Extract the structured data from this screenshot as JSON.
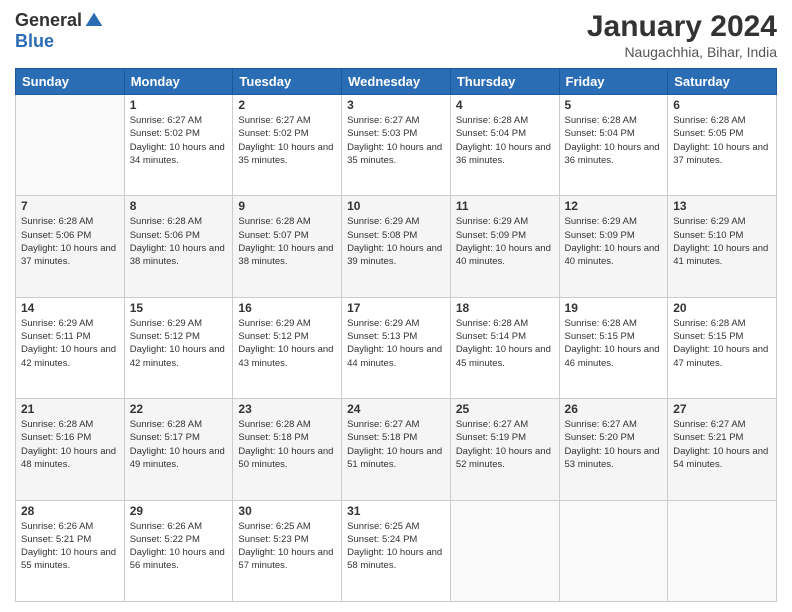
{
  "logo": {
    "general": "General",
    "blue": "Blue"
  },
  "title": "January 2024",
  "location": "Naugachhia, Bihar, India",
  "days_header": [
    "Sunday",
    "Monday",
    "Tuesday",
    "Wednesday",
    "Thursday",
    "Friday",
    "Saturday"
  ],
  "weeks": [
    [
      {
        "day": "",
        "sunrise": "",
        "sunset": "",
        "daylight": ""
      },
      {
        "day": "1",
        "sunrise": "Sunrise: 6:27 AM",
        "sunset": "Sunset: 5:02 PM",
        "daylight": "Daylight: 10 hours and 34 minutes."
      },
      {
        "day": "2",
        "sunrise": "Sunrise: 6:27 AM",
        "sunset": "Sunset: 5:02 PM",
        "daylight": "Daylight: 10 hours and 35 minutes."
      },
      {
        "day": "3",
        "sunrise": "Sunrise: 6:27 AM",
        "sunset": "Sunset: 5:03 PM",
        "daylight": "Daylight: 10 hours and 35 minutes."
      },
      {
        "day": "4",
        "sunrise": "Sunrise: 6:28 AM",
        "sunset": "Sunset: 5:04 PM",
        "daylight": "Daylight: 10 hours and 36 minutes."
      },
      {
        "day": "5",
        "sunrise": "Sunrise: 6:28 AM",
        "sunset": "Sunset: 5:04 PM",
        "daylight": "Daylight: 10 hours and 36 minutes."
      },
      {
        "day": "6",
        "sunrise": "Sunrise: 6:28 AM",
        "sunset": "Sunset: 5:05 PM",
        "daylight": "Daylight: 10 hours and 37 minutes."
      }
    ],
    [
      {
        "day": "7",
        "sunrise": "Sunrise: 6:28 AM",
        "sunset": "Sunset: 5:06 PM",
        "daylight": "Daylight: 10 hours and 37 minutes."
      },
      {
        "day": "8",
        "sunrise": "Sunrise: 6:28 AM",
        "sunset": "Sunset: 5:06 PM",
        "daylight": "Daylight: 10 hours and 38 minutes."
      },
      {
        "day": "9",
        "sunrise": "Sunrise: 6:28 AM",
        "sunset": "Sunset: 5:07 PM",
        "daylight": "Daylight: 10 hours and 38 minutes."
      },
      {
        "day": "10",
        "sunrise": "Sunrise: 6:29 AM",
        "sunset": "Sunset: 5:08 PM",
        "daylight": "Daylight: 10 hours and 39 minutes."
      },
      {
        "day": "11",
        "sunrise": "Sunrise: 6:29 AM",
        "sunset": "Sunset: 5:09 PM",
        "daylight": "Daylight: 10 hours and 40 minutes."
      },
      {
        "day": "12",
        "sunrise": "Sunrise: 6:29 AM",
        "sunset": "Sunset: 5:09 PM",
        "daylight": "Daylight: 10 hours and 40 minutes."
      },
      {
        "day": "13",
        "sunrise": "Sunrise: 6:29 AM",
        "sunset": "Sunset: 5:10 PM",
        "daylight": "Daylight: 10 hours and 41 minutes."
      }
    ],
    [
      {
        "day": "14",
        "sunrise": "Sunrise: 6:29 AM",
        "sunset": "Sunset: 5:11 PM",
        "daylight": "Daylight: 10 hours and 42 minutes."
      },
      {
        "day": "15",
        "sunrise": "Sunrise: 6:29 AM",
        "sunset": "Sunset: 5:12 PM",
        "daylight": "Daylight: 10 hours and 42 minutes."
      },
      {
        "day": "16",
        "sunrise": "Sunrise: 6:29 AM",
        "sunset": "Sunset: 5:12 PM",
        "daylight": "Daylight: 10 hours and 43 minutes."
      },
      {
        "day": "17",
        "sunrise": "Sunrise: 6:29 AM",
        "sunset": "Sunset: 5:13 PM",
        "daylight": "Daylight: 10 hours and 44 minutes."
      },
      {
        "day": "18",
        "sunrise": "Sunrise: 6:28 AM",
        "sunset": "Sunset: 5:14 PM",
        "daylight": "Daylight: 10 hours and 45 minutes."
      },
      {
        "day": "19",
        "sunrise": "Sunrise: 6:28 AM",
        "sunset": "Sunset: 5:15 PM",
        "daylight": "Daylight: 10 hours and 46 minutes."
      },
      {
        "day": "20",
        "sunrise": "Sunrise: 6:28 AM",
        "sunset": "Sunset: 5:15 PM",
        "daylight": "Daylight: 10 hours and 47 minutes."
      }
    ],
    [
      {
        "day": "21",
        "sunrise": "Sunrise: 6:28 AM",
        "sunset": "Sunset: 5:16 PM",
        "daylight": "Daylight: 10 hours and 48 minutes."
      },
      {
        "day": "22",
        "sunrise": "Sunrise: 6:28 AM",
        "sunset": "Sunset: 5:17 PM",
        "daylight": "Daylight: 10 hours and 49 minutes."
      },
      {
        "day": "23",
        "sunrise": "Sunrise: 6:28 AM",
        "sunset": "Sunset: 5:18 PM",
        "daylight": "Daylight: 10 hours and 50 minutes."
      },
      {
        "day": "24",
        "sunrise": "Sunrise: 6:27 AM",
        "sunset": "Sunset: 5:18 PM",
        "daylight": "Daylight: 10 hours and 51 minutes."
      },
      {
        "day": "25",
        "sunrise": "Sunrise: 6:27 AM",
        "sunset": "Sunset: 5:19 PM",
        "daylight": "Daylight: 10 hours and 52 minutes."
      },
      {
        "day": "26",
        "sunrise": "Sunrise: 6:27 AM",
        "sunset": "Sunset: 5:20 PM",
        "daylight": "Daylight: 10 hours and 53 minutes."
      },
      {
        "day": "27",
        "sunrise": "Sunrise: 6:27 AM",
        "sunset": "Sunset: 5:21 PM",
        "daylight": "Daylight: 10 hours and 54 minutes."
      }
    ],
    [
      {
        "day": "28",
        "sunrise": "Sunrise: 6:26 AM",
        "sunset": "Sunset: 5:21 PM",
        "daylight": "Daylight: 10 hours and 55 minutes."
      },
      {
        "day": "29",
        "sunrise": "Sunrise: 6:26 AM",
        "sunset": "Sunset: 5:22 PM",
        "daylight": "Daylight: 10 hours and 56 minutes."
      },
      {
        "day": "30",
        "sunrise": "Sunrise: 6:25 AM",
        "sunset": "Sunset: 5:23 PM",
        "daylight": "Daylight: 10 hours and 57 minutes."
      },
      {
        "day": "31",
        "sunrise": "Sunrise: 6:25 AM",
        "sunset": "Sunset: 5:24 PM",
        "daylight": "Daylight: 10 hours and 58 minutes."
      },
      {
        "day": "",
        "sunrise": "",
        "sunset": "",
        "daylight": ""
      },
      {
        "day": "",
        "sunrise": "",
        "sunset": "",
        "daylight": ""
      },
      {
        "day": "",
        "sunrise": "",
        "sunset": "",
        "daylight": ""
      }
    ]
  ]
}
